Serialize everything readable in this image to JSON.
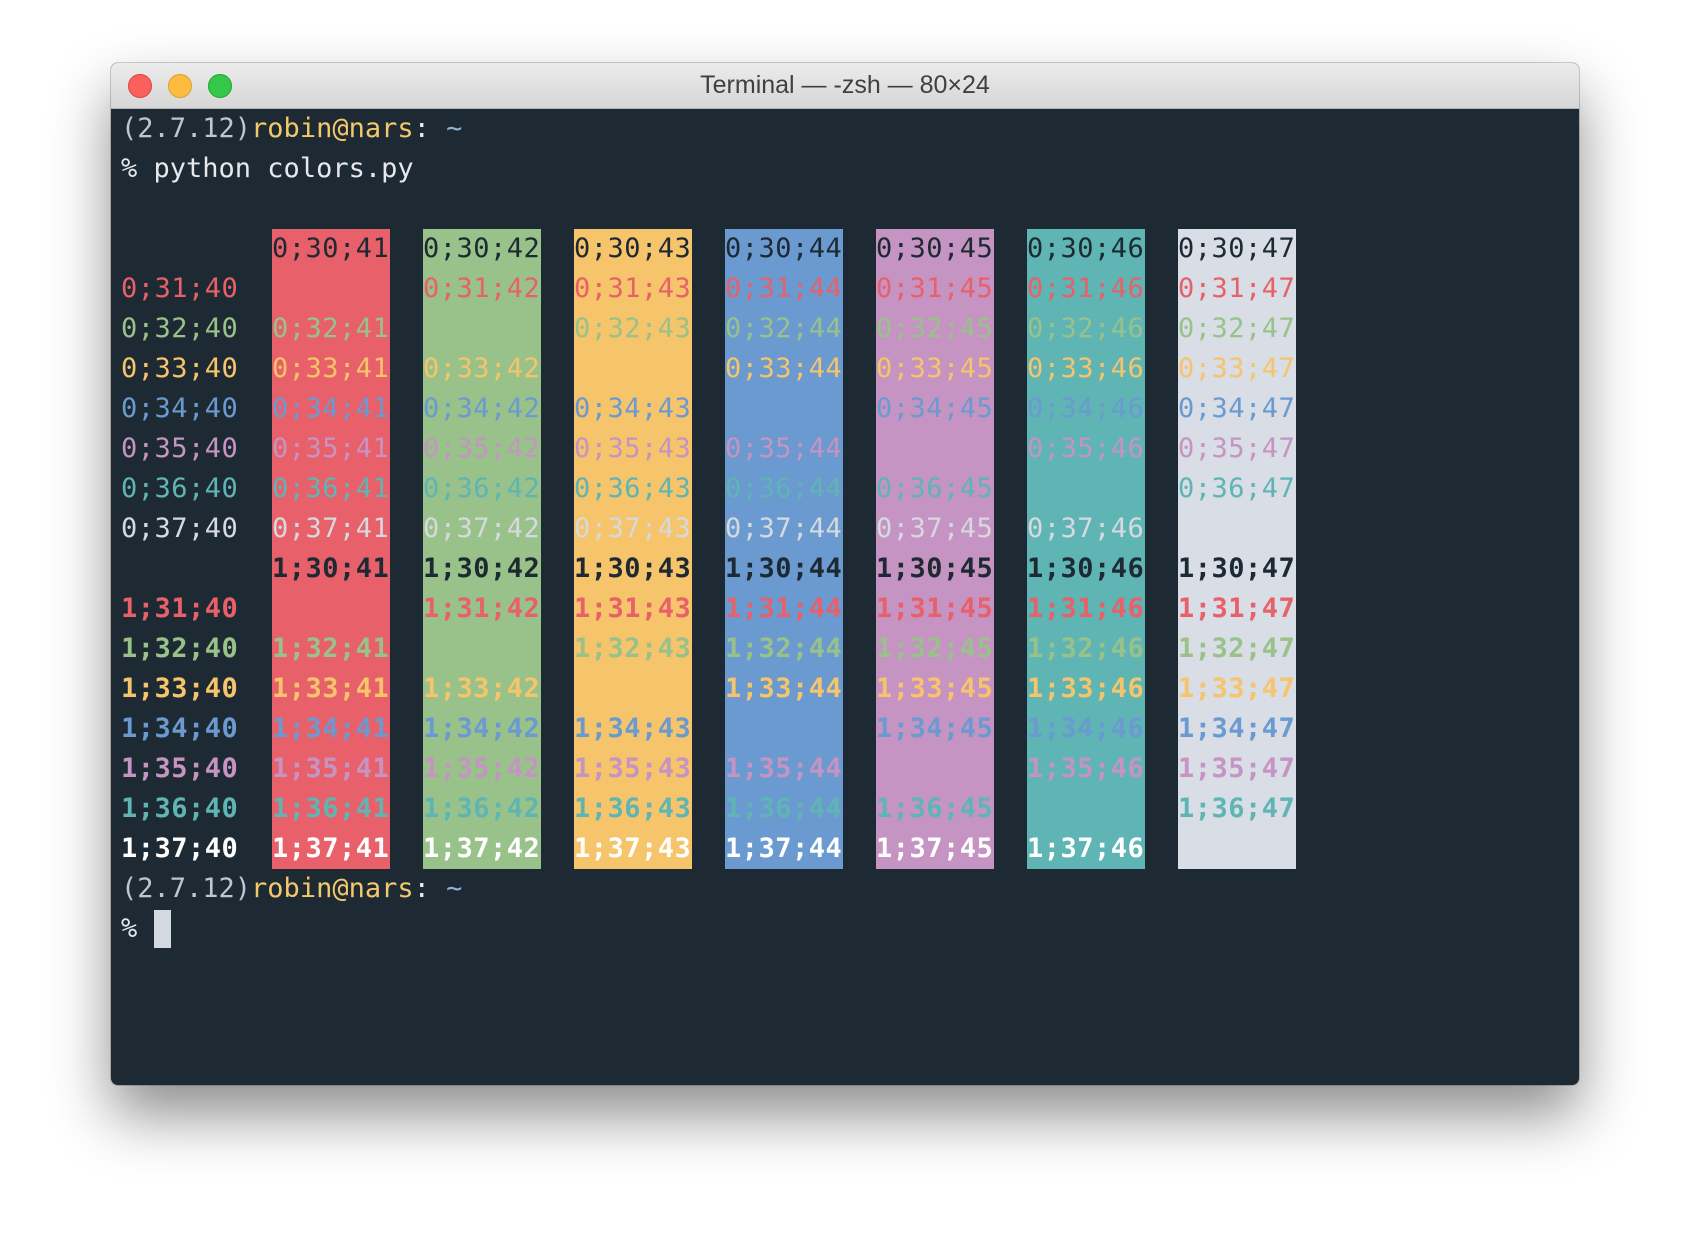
{
  "window": {
    "title": "Terminal — -zsh — 80×24"
  },
  "prompt1": {
    "env": "(2.7.12)",
    "user_host": "robin@nars",
    "path_sep": ": ",
    "path": "~"
  },
  "command": {
    "symbol": "% ",
    "text": "python colors.py"
  },
  "prompt2": {
    "env": "(2.7.12)",
    "user_host": "robin@nars",
    "path_sep": ": ",
    "path": "~"
  },
  "input_line": {
    "symbol": "% ",
    "value": ""
  },
  "colors": {
    "terminal_bg": "#1e2a33",
    "env": "#c0c5ce",
    "user": "#f3c86b",
    "path": "#8fb1d9",
    "fg": {
      "30": "#1e2a33",
      "31": "#e8606a",
      "32": "#98c28a",
      "33": "#f6c46a",
      "34": "#6a9ad0",
      "35": "#c594c2",
      "36": "#5fb4b4",
      "37": "#ffffff",
      "default_dim": "#d6d9de"
    },
    "bg": {
      "40": "#1e2a33",
      "41": "#e8606a",
      "42": "#98c28a",
      "43": "#f6c46a",
      "44": "#6a9ad0",
      "45": "#c594c2",
      "46": "#5fb4b4",
      "47": "#d8dde6"
    }
  },
  "color_table": {
    "rows": [
      [
        "",
        "0;30;41",
        "0;30;42",
        "0;30;43",
        "0;30;44",
        "0;30;45",
        "0;30;46",
        "0;30;47"
      ],
      [
        "0;31;40",
        "",
        "0;31;42",
        "0;31;43",
        "0;31;44",
        "0;31;45",
        "0;31;46",
        "0;31;47"
      ],
      [
        "0;32;40",
        "0;32;41",
        "",
        "0;32;43",
        "0;32;44",
        "0;32;45",
        "0;32;46",
        "0;32;47"
      ],
      [
        "0;33;40",
        "0;33;41",
        "0;33;42",
        "",
        "0;33;44",
        "0;33;45",
        "0;33;46",
        "0;33;47"
      ],
      [
        "0;34;40",
        "0;34;41",
        "0;34;42",
        "0;34;43",
        "",
        "0;34;45",
        "0;34;46",
        "0;34;47"
      ],
      [
        "0;35;40",
        "0;35;41",
        "0;35;42",
        "0;35;43",
        "0;35;44",
        "",
        "0;35;46",
        "0;35;47"
      ],
      [
        "0;36;40",
        "0;36;41",
        "0;36;42",
        "0;36;43",
        "0;36;44",
        "0;36;45",
        "",
        "0;36;47"
      ],
      [
        "0;37;40",
        "0;37;41",
        "0;37;42",
        "0;37;43",
        "0;37;44",
        "0;37;45",
        "0;37;46",
        ""
      ],
      [
        "",
        "1;30;41",
        "1;30;42",
        "1;30;43",
        "1;30;44",
        "1;30;45",
        "1;30;46",
        "1;30;47"
      ],
      [
        "1;31;40",
        "",
        "1;31;42",
        "1;31;43",
        "1;31;44",
        "1;31;45",
        "1;31;46",
        "1;31;47"
      ],
      [
        "1;32;40",
        "1;32;41",
        "",
        "1;32;43",
        "1;32;44",
        "1;32;45",
        "1;32;46",
        "1;32;47"
      ],
      [
        "1;33;40",
        "1;33;41",
        "1;33;42",
        "",
        "1;33;44",
        "1;33;45",
        "1;33;46",
        "1;33;47"
      ],
      [
        "1;34;40",
        "1;34;41",
        "1;34;42",
        "1;34;43",
        "",
        "1;34;45",
        "1;34;46",
        "1;34;47"
      ],
      [
        "1;35;40",
        "1;35;41",
        "1;35;42",
        "1;35;43",
        "1;35;44",
        "",
        "1;35;46",
        "1;35;47"
      ],
      [
        "1;36;40",
        "1;36;41",
        "1;36;42",
        "1;36;43",
        "1;36;44",
        "1;36;45",
        "",
        "1;36;47"
      ],
      [
        "1;37;40",
        "1;37;41",
        "1;37;42",
        "1;37;43",
        "1;37;44",
        "1;37;45",
        "1;37;46",
        ""
      ]
    ]
  }
}
